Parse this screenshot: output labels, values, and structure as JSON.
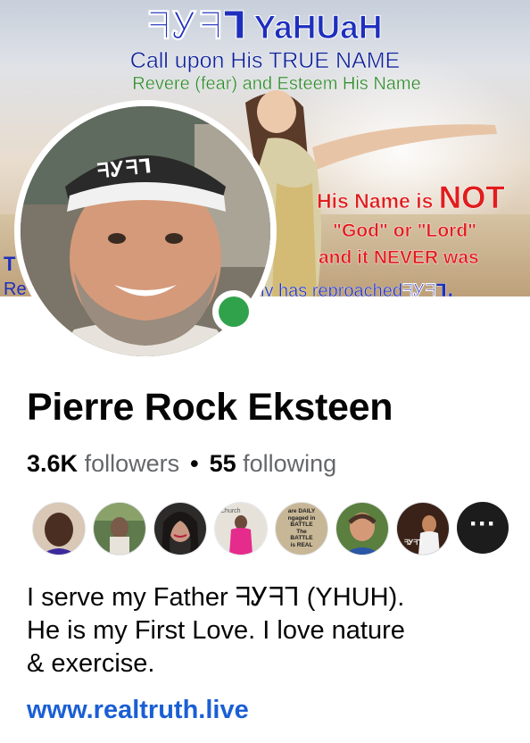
{
  "cover": {
    "title_paleo": "ᖷᎩᖷᒣ",
    "title_latin": "YaHUaH",
    "line_call": "Call upon His TRUE NAME",
    "line_revere": "Revere (fear) and Esteem His Name",
    "not_prefix": "His Name is ",
    "not_word": "NOT",
    "god_lord": "\"God\" or \"Lord\"",
    "never": "and it NEVER was",
    "left_fragment_1": "T",
    "left_fragment_2": "Re",
    "reproach_text": "ly has reproached",
    "reproach_paleo": "ᖷᎩᖷᒣ."
  },
  "avatar": {
    "cap_text": "ᖷᎩᖷᒣ",
    "online_color": "#31a24c"
  },
  "profile": {
    "name": "Pierre Rock Eksteen",
    "followers_count": "3.6K",
    "followers_label": "followers",
    "separator": "•",
    "following_count": "55",
    "following_label": "following"
  },
  "friends": {
    "more_label": "···",
    "thumb_texts": {
      "t4": "Church",
      "t5_a": "are DAILY",
      "t5_b": "ngaged in",
      "t5_c": "BATTLE",
      "t5_d": "The",
      "t5_e": "BATTLE",
      "t5_f": "is REAL",
      "t7": "ᖷᎩᖷᒣ"
    }
  },
  "bio": {
    "line1_pre": "I serve my Father ",
    "line1_paleo": "ᖷᎩᖷᒣ",
    "line1_post": " (YHUH).",
    "line2": "He is my First Love. I love nature",
    "line3": "& exercise."
  },
  "website": "www.realtruth.live",
  "colors": {
    "link": "#1a5fd4",
    "cover_blue": "#1e2fbd",
    "cover_green": "#2d8a2a",
    "cover_red": "#e01d1d"
  }
}
